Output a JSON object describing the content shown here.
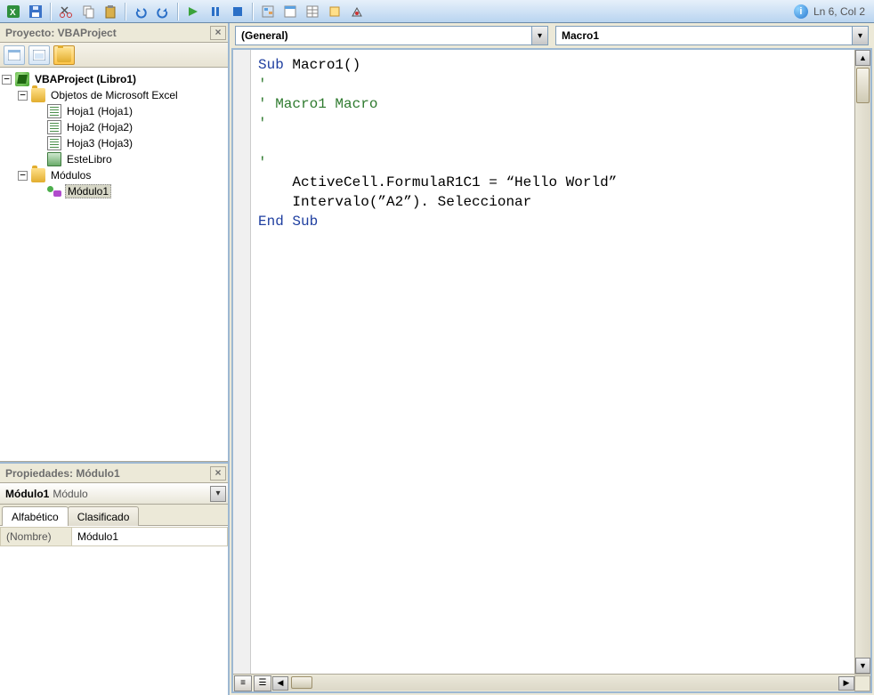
{
  "statusbar": {
    "cursor": "Ln 6, Col 2"
  },
  "project_pane": {
    "title": "Proyecto: VBAProject",
    "tree": {
      "root": "VBAProject (Libro1)",
      "objects_folder": "Objetos de Microsoft Excel",
      "sheets": [
        "Hoja1 (Hoja1)",
        "Hoja2 (Hoja2)",
        "Hoja3 (Hoja3)"
      ],
      "workbook": "EsteLibro",
      "modules_folder": "Módulos",
      "module1": "Módulo1"
    }
  },
  "properties_pane": {
    "title": "Propiedades: Módulo1",
    "object_name": "Módulo1",
    "object_type": "Módulo",
    "tabs": {
      "alpha": "Alfabético",
      "categorized": "Clasificado"
    },
    "rows": {
      "name_label": "(Nombre)",
      "name_value": "Módulo1"
    }
  },
  "editor": {
    "scope": "(General)",
    "proc": "Macro1",
    "code": {
      "l1a": "Sub",
      "l1b": " Macro1()",
      "l2": "'",
      "l3": "' Macro1 Macro",
      "l4": "'",
      "l5": "",
      "l6": "'",
      "l7": "    ActiveCell.FormulaR1C1 = “Hello World”",
      "l8": "    Intervalo(”A2”). Seleccionar",
      "l9a": "End Sub"
    }
  }
}
